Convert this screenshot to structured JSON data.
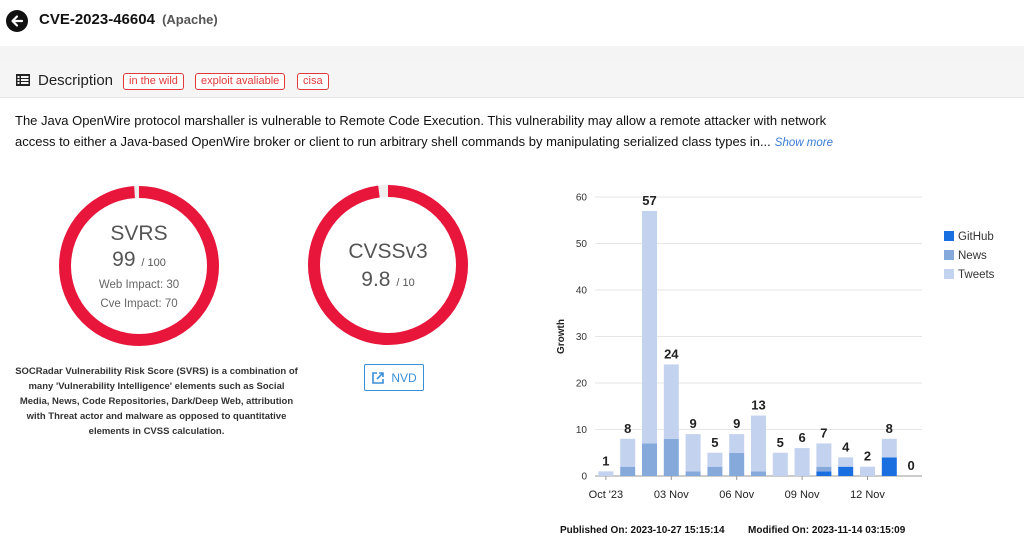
{
  "header": {
    "cve_id": "CVE-2023-46604",
    "vendor": "(Apache)"
  },
  "description": {
    "title": "Description",
    "tags": [
      "in the wild",
      "exploit avaliable",
      "cisa"
    ],
    "text": "The Java OpenWire protocol marshaller is vulnerable to Remote Code Execution. This vulnerability may allow a remote attacker with network access to either a Java-based OpenWire broker or client to run arbitrary shell commands by manipulating serialized class types in...",
    "show_more": "Show more"
  },
  "svrs": {
    "label": "SVRS",
    "score": "99",
    "max": "/ 100",
    "web_impact": "Web Impact: 30",
    "cve_impact": "Cve Impact: 70",
    "fill_fraction": 0.99,
    "color": "#e8163a",
    "caption": "SOCRadar Vulnerability Risk Score (SVRS) is a combination of many 'Vulnerability Intelligence' elements such as Social Media, News, Code Repositories, Dark/Deep Web, attribution with Threat actor and malware as opposed to quantitative elements in CVSS calculation."
  },
  "cvss": {
    "label": "CVSSv3",
    "score": "9.8",
    "max": "/ 10",
    "fill_fraction": 0.98,
    "color": "#e8163a",
    "nvd_label": "NVD"
  },
  "chart_data": {
    "type": "bar",
    "ylabel": "Growth",
    "ylim": [
      0,
      60
    ],
    "yticks": [
      0,
      10,
      20,
      30,
      40,
      50,
      60
    ],
    "x_tick_labels": [
      {
        "index": 0,
        "label": "Oct '23"
      },
      {
        "index": 3,
        "label": "03 Nov"
      },
      {
        "index": 6,
        "label": "06 Nov"
      },
      {
        "index": 9,
        "label": "09 Nov"
      },
      {
        "index": 12,
        "label": "12 Nov"
      }
    ],
    "totals": [
      1,
      8,
      57,
      24,
      9,
      5,
      9,
      13,
      5,
      6,
      7,
      4,
      2,
      8,
      0
    ],
    "series": [
      {
        "name": "GitHub",
        "color": "#1a6fe0",
        "values": [
          0,
          0,
          0,
          0,
          0,
          0,
          0,
          0,
          0,
          0,
          1,
          2,
          0,
          4,
          0
        ]
      },
      {
        "name": "News",
        "color": "#86a9dc",
        "values": [
          0,
          2,
          7,
          8,
          1,
          2,
          5,
          1,
          0,
          0,
          1,
          0,
          0,
          0,
          0
        ]
      },
      {
        "name": "Tweets",
        "color": "#c3d2ee",
        "values": [
          1,
          6,
          50,
          16,
          8,
          3,
          4,
          12,
          5,
          6,
          5,
          2,
          2,
          4,
          0
        ]
      }
    ],
    "legend_position": "right"
  },
  "footer": {
    "published": "Published On: 2023-10-27 15:15:14",
    "modified": "Modified On: 2023-11-14 03:15:09"
  }
}
